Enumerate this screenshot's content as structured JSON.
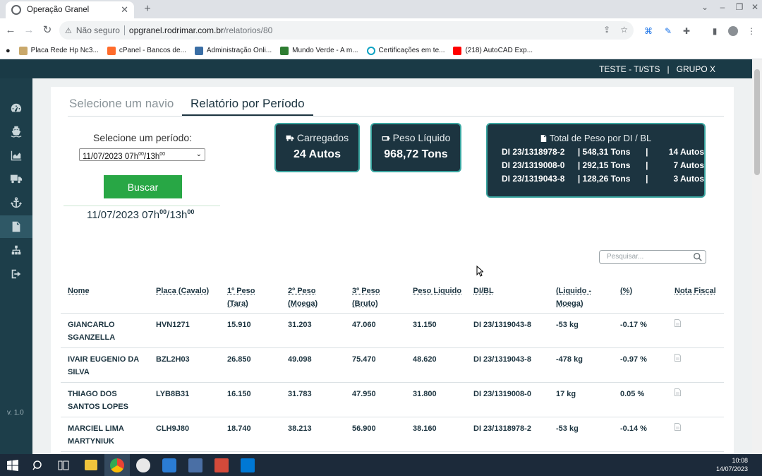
{
  "browser": {
    "tab_title": "Operação Granel",
    "omnibox": {
      "security_label": "Não seguro",
      "host": "opgranel.rodrimar.com.br",
      "path": "/relatorios/80"
    },
    "bookmarks": [
      {
        "label": "Placa Rede Hp Nc3...",
        "color": "#c9a86b"
      },
      {
        "label": "cPanel - Bancos de...",
        "color": "#ff6c2c"
      },
      {
        "label": "Administração Onli...",
        "color": "#3a6ea5"
      },
      {
        "label": "Mundo Verde - A m...",
        "color": "#2e7d32"
      },
      {
        "label": "Certificações em te...",
        "color": "#0aa1c2"
      },
      {
        "label": "(218) AutoCAD Exp...",
        "color": "#ff0000"
      }
    ]
  },
  "header": {
    "user": "TESTE - TI/STS",
    "separator": "|",
    "group": "GRUPO X"
  },
  "sidebar": {
    "items": [
      {
        "icon": "dashboard-icon"
      },
      {
        "icon": "ship-icon"
      },
      {
        "icon": "area-chart-icon"
      },
      {
        "icon": "truck-icon"
      },
      {
        "icon": "anchor-icon"
      },
      {
        "icon": "document-icon",
        "active": true
      },
      {
        "icon": "sitemap-icon"
      },
      {
        "icon": "sign-out-icon"
      }
    ],
    "version": "v. 1.0"
  },
  "tabs": [
    {
      "label": "Selecione um navio"
    },
    {
      "label": "Relatório por Período"
    }
  ],
  "period": {
    "label": "Selecione um período:",
    "selected": "11/07/2023 07hººº/13hººº",
    "selected_main": "11/07/2023 07h",
    "selected_sup1": "00",
    "selected_mid": "/13h",
    "selected_sup2": "00",
    "button": "Buscar",
    "display_main": "11/07/2023 07h",
    "display_sup1": "00",
    "display_mid": "/13h",
    "display_sup2": "00"
  },
  "stats": {
    "carregados": {
      "label": "Carregados",
      "value": "24 Autos"
    },
    "peso_liquido": {
      "label": "Peso Líquido",
      "value": "968,72 Tons"
    }
  },
  "di_summary": {
    "title": "Total de Peso por DI / BL",
    "rows": [
      {
        "di": "DI 23/1318978-2",
        "tons": "| 548,31 Tons",
        "sep": "|",
        "autos": "14 Autos"
      },
      {
        "di": "DI 23/1319008-0",
        "tons": "| 292,15 Tons",
        "sep": "|",
        "autos": "7 Autos"
      },
      {
        "di": "DI 23/1319043-8",
        "tons": "| 128,26 Tons",
        "sep": "|",
        "autos": "3 Autos"
      }
    ]
  },
  "search": {
    "placeholder": "Pesquisar..."
  },
  "table": {
    "headers": [
      {
        "line1": "Nome",
        "line2": ""
      },
      {
        "line1": "Placa (Cavalo)",
        "line2": ""
      },
      {
        "line1": "1º Peso",
        "line2": "(Tara)"
      },
      {
        "line1": "2º Peso",
        "line2": "(Moega)"
      },
      {
        "line1": "3º Peso",
        "line2": "(Bruto)"
      },
      {
        "line1": "Peso Liquido",
        "line2": ""
      },
      {
        "line1": "DI/BL",
        "line2": ""
      },
      {
        "line1": "(Liquido -",
        "line2": "Moega)"
      },
      {
        "line1": "(%)",
        "line2": ""
      },
      {
        "line1": "Nota Fiscal",
        "line2": ""
      }
    ],
    "rows": [
      {
        "nome": "GIANCARLO SGANZELLA",
        "placa": "HVN1271",
        "p1": "15.910",
        "p2": "31.203",
        "p3": "47.060",
        "liquido": "31.150",
        "di": "DI 23/1319043-8",
        "diff": "-53 kg",
        "pct": "-0.17 %"
      },
      {
        "nome": "IVAIR EUGENIO DA SILVA",
        "placa": "BZL2H03",
        "p1": "26.850",
        "p2": "49.098",
        "p3": "75.470",
        "liquido": "48.620",
        "di": "DI 23/1319043-8",
        "diff": "-478 kg",
        "pct": "-0.97 %"
      },
      {
        "nome": "THIAGO DOS SANTOS LOPES",
        "placa": "LYB8B31",
        "p1": "16.150",
        "p2": "31.783",
        "p3": "47.950",
        "liquido": "31.800",
        "di": "DI 23/1319008-0",
        "diff": "17 kg",
        "pct": "0.05 %"
      },
      {
        "nome": "MARCIEL LIMA MARTYNIUK",
        "placa": "CLH9J80",
        "p1": "18.740",
        "p2": "38.213",
        "p3": "56.900",
        "liquido": "38.160",
        "di": "DI 23/1318978-2",
        "diff": "-53 kg",
        "pct": "-0.14 %"
      }
    ]
  },
  "taskbar": {
    "time": "10:08",
    "date": "14/07/2023"
  }
}
